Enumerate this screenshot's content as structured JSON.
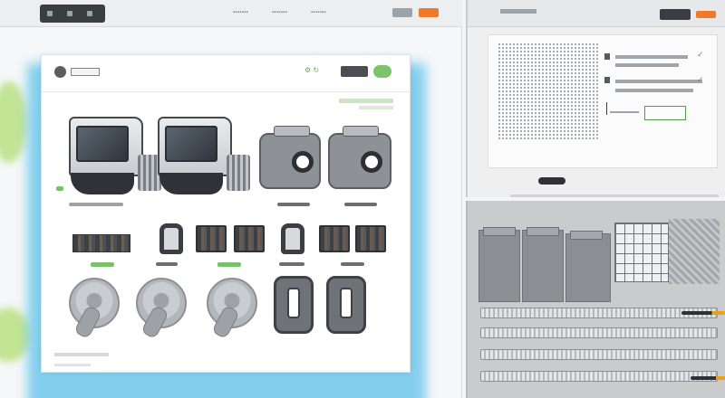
{
  "window": {
    "menu": [
      "▪▪▪▪▪▪▪",
      "▪▪▪▪▪▪▪",
      "▪▪▪▪▪▪▪"
    ]
  },
  "card": {
    "doc_label": "",
    "head_icons": "⚙ ↻"
  },
  "colors": {
    "accent_green": "#78c16a",
    "accent_orange": "#f07a2a",
    "glow_blue": "#6fc8ec",
    "dark": "#3a3d42"
  },
  "right_top": {
    "check_1": "✓",
    "check_2": "✓"
  }
}
